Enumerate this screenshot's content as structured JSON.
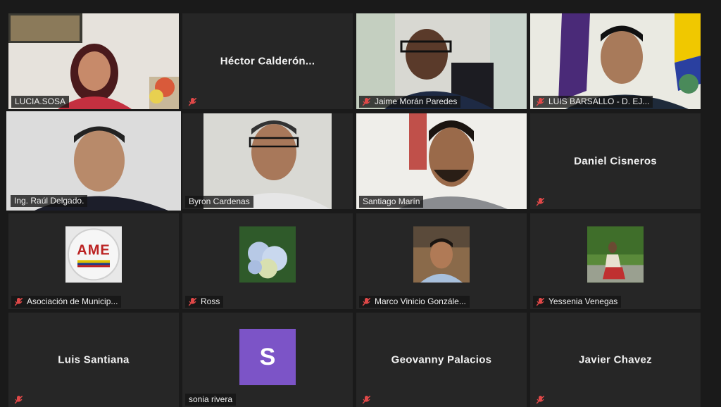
{
  "participants": {
    "lucia": "LUCIA.SOSA",
    "hector": "Héctor Calderón...",
    "jaime": "Jaime Morán Paredes",
    "luis_b": "LUIS BARSALLO - D. EJ...",
    "raul": "Ing. Raúl Delgado.",
    "byron": "Byron Cardenas",
    "santiago": "Santiago Marín",
    "daniel": "Daniel Cisneros",
    "asociacion": "Asociación de Municip...",
    "ross": "Ross",
    "marco": "Marco Vinicio Gonzále...",
    "yessenia": "Yessenia Venegas",
    "luis_s": "Luis Santiana",
    "sonia": "sonia rivera",
    "geovanny": "Geovanny Palacios",
    "javier": "Javier Chavez"
  },
  "ame_logo_text": "AME",
  "sonia_initial": "S",
  "colors": {
    "active_border": "#d6e86a",
    "muted_icon": "#e04848",
    "avatar_s": "#7c54c7"
  }
}
